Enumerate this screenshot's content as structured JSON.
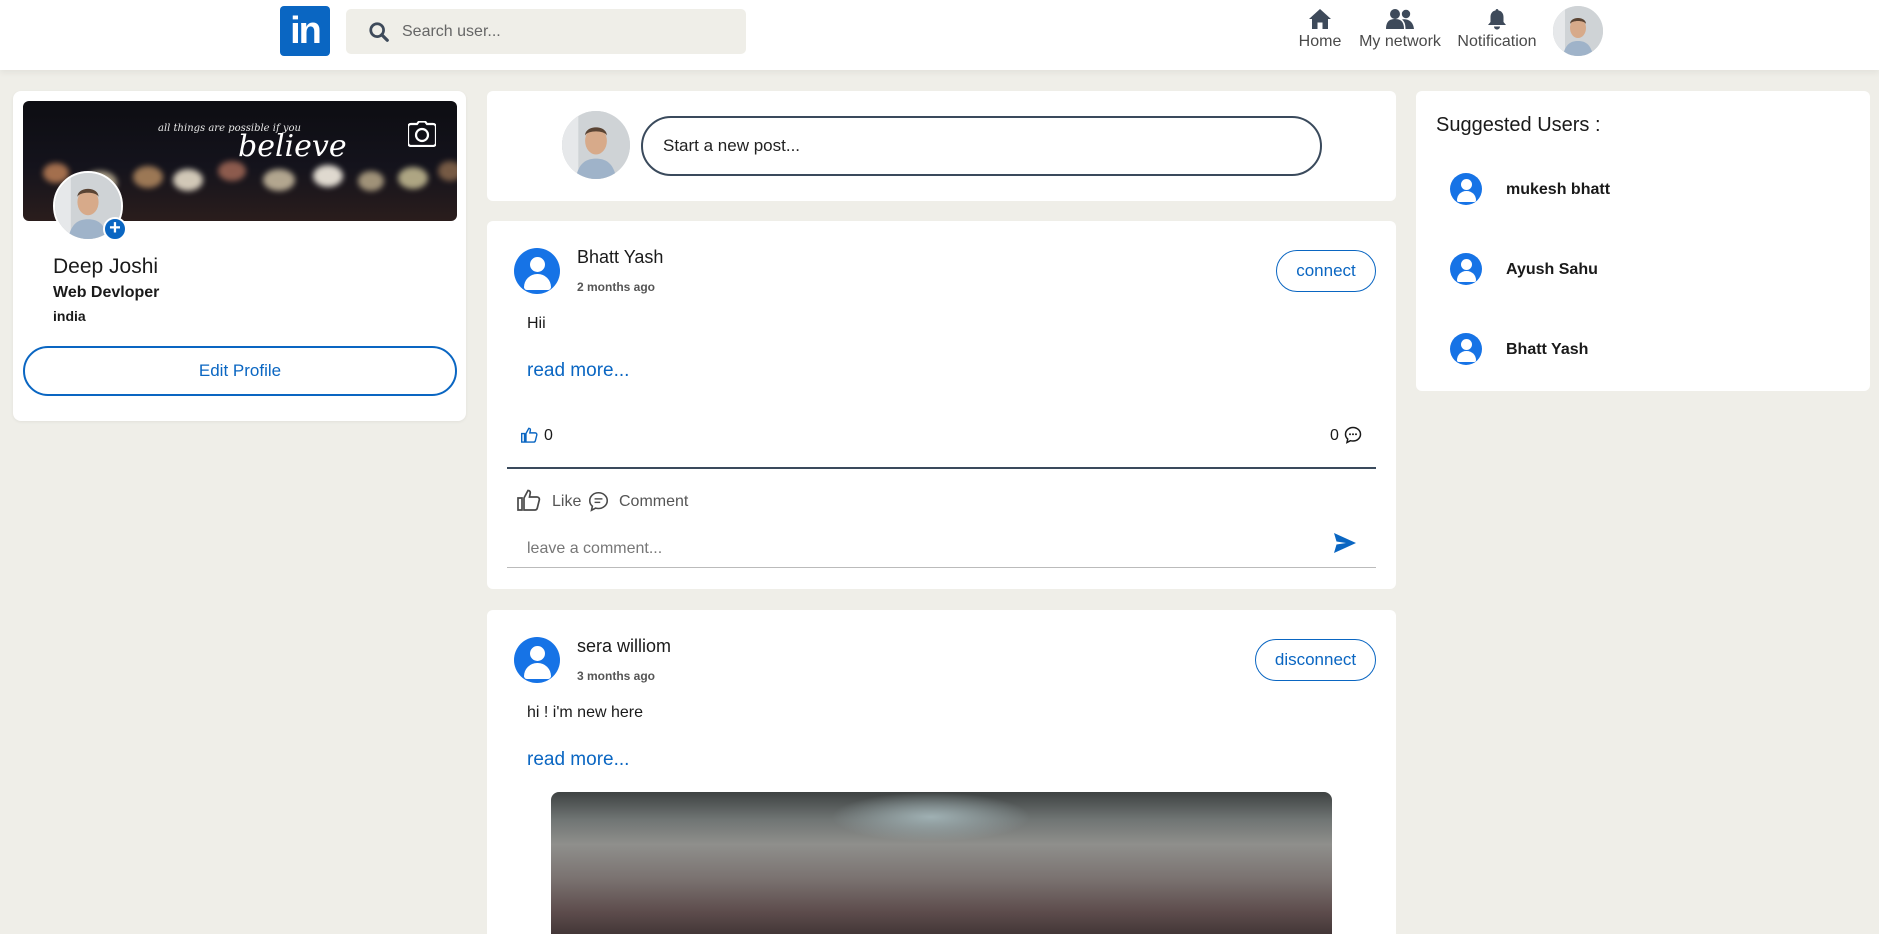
{
  "brand": {
    "logo_text": "in"
  },
  "search": {
    "placeholder": "Search user..."
  },
  "nav": {
    "home": "Home",
    "network": "My network",
    "notification": "Notification"
  },
  "profile": {
    "banner_quote_small": "all things are possible if you",
    "banner_quote_big": "believe",
    "name": "Deep Joshi",
    "role": "Web Devloper",
    "location": "india",
    "edit_label": "Edit Profile"
  },
  "composer": {
    "label": "Start a new post..."
  },
  "posts": [
    {
      "author": "Bhatt Yash",
      "time": "2 months ago",
      "connect_label": "connect",
      "text": "Hii",
      "read_more": "read more...",
      "likes": "0",
      "comments": "0",
      "like_label": "Like",
      "comment_label": "Comment",
      "comment_placeholder": "leave a comment..."
    },
    {
      "author": "sera williom",
      "time": "3 months ago",
      "connect_label": "disconnect",
      "text": "hi ! i'm new here",
      "read_more": "read more..."
    }
  ],
  "suggested": {
    "title": "Suggested Users :",
    "users": [
      {
        "name": "mukesh bhatt"
      },
      {
        "name": "Ayush Sahu"
      },
      {
        "name": "Bhatt Yash"
      }
    ]
  },
  "colors": {
    "brand": "#0a66c2",
    "user_icon": "#1673e6",
    "page_bg": "#efeee8"
  }
}
